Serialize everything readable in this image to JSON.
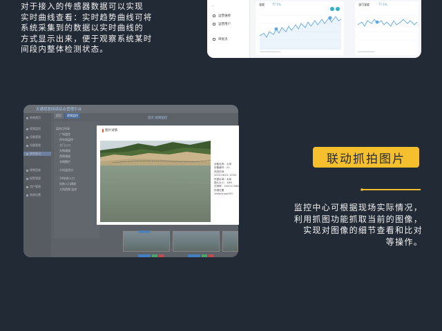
{
  "intro": {
    "lines": [
      "对于接入的传感器数据可以实现",
      "实时曲线查看：实时趋势曲线可将",
      "系统采集到的数据以实时曲线的",
      "方式显示出来，便于观察系统某时",
      "间段内整体检测状态。"
    ]
  },
  "chart_screenshot": {
    "sidebar_items": [
      "运营维修",
      "运营用户",
      "审批流"
    ],
    "panels": [
      {
        "title": "湿度",
        "value": "77.1%"
      },
      {
        "title": "温可湿度",
        "value": "77.1%"
      }
    ],
    "colors": {
      "line": "#5fa8e6",
      "accent": "#2fb1c9"
    }
  },
  "video_screenshot": {
    "app_title": "天通视联网络综合管理平台",
    "tabs": [
      "首页",
      "视频监控"
    ],
    "breadcrumb": "首页 视频监控",
    "sidebar_items": [
      "系统首页",
      "视频监控",
      "设备管理",
      "设备管理",
      "视频联动",
      "视频回放",
      "报警管理",
      "用户管理",
      "系统设置"
    ],
    "tree_nodes": [
      "监控点列表",
      "广场监控",
      "停车场监控",
      "大门入口",
      "东侧通道",
      "西侧通道",
      "东侧围栏",
      "大坝监控点",
      "1#机房入口",
      "机房入口通道",
      "大坝西侧 监控"
    ],
    "modal": {
      "title": "图片详情",
      "info_lines": [
        "设备名称：大坝",
        "设备编号：01",
        "抓拍时间",
        "2023-06-01 10:22",
        "所属区域：水库",
        "图片大小：1MB",
        "分辨率：1920×1080",
        "存储位置",
        "/data/snap/001"
      ]
    }
  },
  "feature": {
    "badge": "联动抓拍图片",
    "lines": [
      "监控中心可根据现场实际情况，",
      "利用抓图功能抓取当前的图像，",
      "实现对图像的细节查看和比对",
      "等操作。"
    ],
    "accent_color": "#f6bf2e"
  }
}
